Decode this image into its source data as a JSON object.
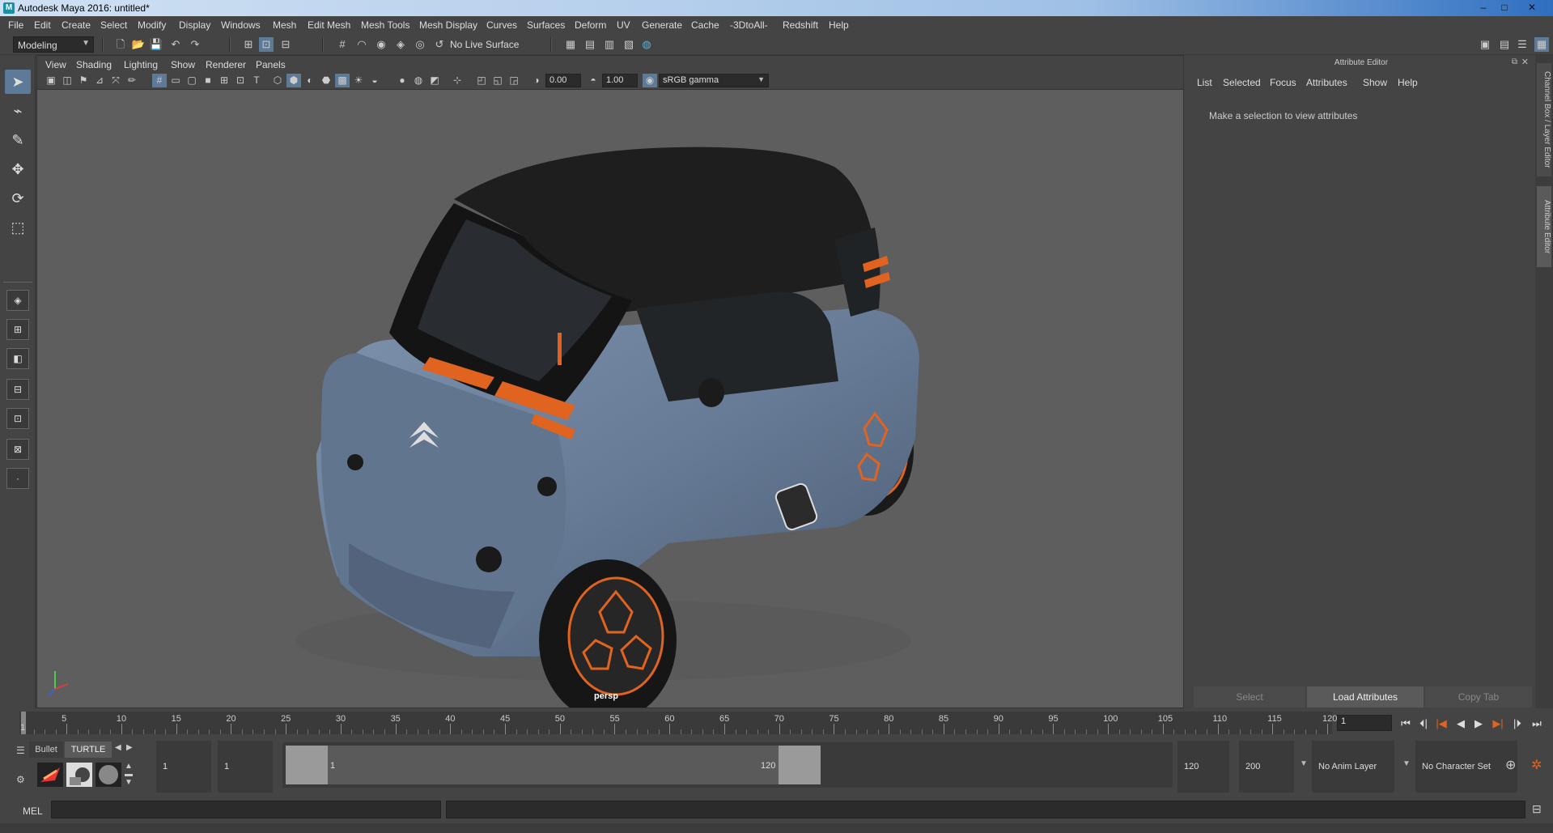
{
  "window": {
    "title": "Autodesk Maya 2016: untitled*",
    "minimize": "–",
    "maximize": "□",
    "close": "✕"
  },
  "menubar": [
    "File",
    "Edit",
    "Create",
    "Select",
    "Modify",
    "Display",
    "Windows",
    "Mesh",
    "Edit Mesh",
    "Mesh Tools",
    "Mesh Display",
    "Curves",
    "Surfaces",
    "Deform",
    "UV",
    "Generate",
    "Cache",
    "-3DtoAll-",
    "Redshift",
    "Help"
  ],
  "statusline": {
    "mode": "Modeling",
    "live_surface": "No Live Surface"
  },
  "viewport": {
    "menu": [
      "View",
      "Shading",
      "Lighting",
      "Show",
      "Renderer",
      "Panels"
    ],
    "exposure": "0.00",
    "gamma": "1.00",
    "color_space": "sRGB gamma",
    "camera": "persp"
  },
  "attribute_editor": {
    "title": "Attribute Editor",
    "menu": [
      "List",
      "Selected",
      "Focus",
      "Attributes",
      "Show",
      "Help"
    ],
    "message": "Make a selection to view attributes",
    "buttons": {
      "select": "Select",
      "load": "Load Attributes",
      "copy": "Copy Tab"
    }
  },
  "side_tabs": {
    "channel_box": "Channel Box / Layer Editor",
    "attribute_editor": "Attribute Editor"
  },
  "timeline": {
    "labels": [
      "1",
      "5",
      "10",
      "15",
      "20",
      "25",
      "30",
      "35",
      "40",
      "45",
      "50",
      "55",
      "60",
      "65",
      "70",
      "75",
      "80",
      "85",
      "90",
      "95",
      "100",
      "105",
      "110",
      "115",
      "120"
    ],
    "start": 1,
    "end": 120,
    "current_frame": "1"
  },
  "shelf": {
    "tab1": "Bullet",
    "tab2": "TURTLE"
  },
  "range": {
    "start_time": "1",
    "playback_start": "1",
    "range_start_label": "1",
    "range_end_label": "120",
    "playback_end": "120",
    "end_time": "200",
    "anim_layer": "No Anim Layer",
    "character_set": "No Character Set"
  },
  "commandline": {
    "label": "MEL"
  },
  "colors": {
    "accent": "#5d7a99",
    "car_body": "#6b7f9a",
    "car_roof": "#1e1e1e",
    "orange": "#e0631f"
  }
}
